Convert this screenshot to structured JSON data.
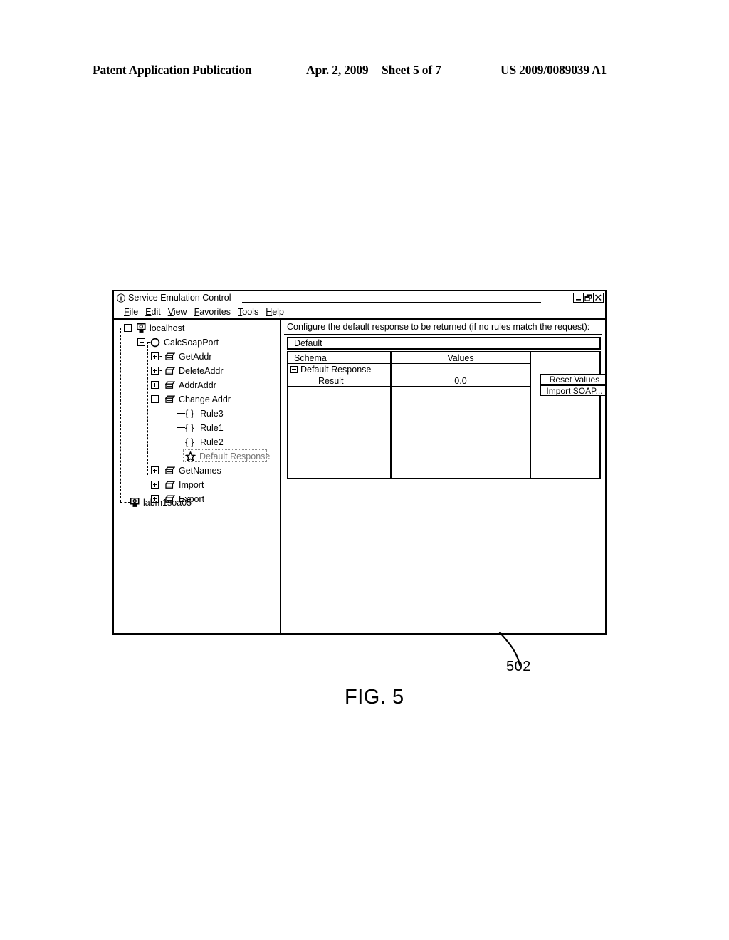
{
  "page_header": {
    "publication": "Patent Application Publication",
    "date": "Apr. 2, 2009",
    "sheet": "Sheet 5 of 7",
    "patent_number": "US 2009/0089039 A1"
  },
  "figure": {
    "reference_number": "502",
    "caption": "FIG. 5"
  },
  "window": {
    "title": "Service Emulation Control",
    "info_icon": "info-icon",
    "controls": [
      {
        "name": "minimize",
        "glyph": "minimize-icon"
      },
      {
        "name": "restore",
        "glyph": "restore-icon"
      },
      {
        "name": "close",
        "glyph": "close-icon"
      }
    ],
    "menu": [
      {
        "mnemonic": "F",
        "rest": "ile"
      },
      {
        "mnemonic": "E",
        "rest": "dit"
      },
      {
        "mnemonic": "V",
        "rest": "iew"
      },
      {
        "mnemonic": "F",
        "rest": "avorites"
      },
      {
        "mnemonic": "T",
        "rest": "ools"
      },
      {
        "mnemonic": "H",
        "rest": "elp"
      }
    ]
  },
  "tree": {
    "nodes": [
      {
        "label": "localhost",
        "icon": "computer-icon",
        "expander": "minus",
        "selected": false
      },
      {
        "label": "CalcSoapPort",
        "icon": "circle-icon",
        "expander": "minus",
        "selected": false
      },
      {
        "label": "GetAddr",
        "icon": "document-icon",
        "expander": "plus",
        "selected": false
      },
      {
        "label": "DeleteAddr",
        "icon": "document-icon",
        "expander": "plus",
        "selected": false
      },
      {
        "label": "AddrAddr",
        "icon": "document-icon",
        "expander": "plus",
        "selected": false
      },
      {
        "label": "Change Addr",
        "icon": "document-icon",
        "expander": "minus",
        "selected": false
      },
      {
        "label": "Rule3",
        "icon": "braces-icon",
        "expander": "none",
        "selected": false
      },
      {
        "label": "Rule1",
        "icon": "braces-icon",
        "expander": "none",
        "selected": false
      },
      {
        "label": "Rule2",
        "icon": "braces-icon",
        "expander": "none",
        "selected": false
      },
      {
        "label": "Default Response",
        "icon": "star-icon",
        "expander": "none",
        "selected": true
      },
      {
        "label": "GetNames",
        "icon": "document-icon",
        "expander": "plus",
        "selected": false
      },
      {
        "label": "Import",
        "icon": "document-icon",
        "expander": "plus",
        "selected": false
      },
      {
        "label": "Export",
        "icon": "document-icon",
        "expander": "plus",
        "selected": false
      },
      {
        "label": "labm1soa05",
        "icon": "computer-icon",
        "expander": "none",
        "selected": false
      }
    ]
  },
  "detail": {
    "instruction": "Configure the default response to be returned (if no rules match the request):",
    "default_field_value": "Default",
    "table": {
      "headers": [
        "Schema",
        "Values"
      ],
      "rows": [
        {
          "schema": "Default Response",
          "value": "",
          "collapse": true,
          "indent": false
        },
        {
          "schema": "Result",
          "value": "0.0",
          "collapse": false,
          "indent": true
        }
      ]
    },
    "buttons": [
      {
        "label": "Reset Values"
      },
      {
        "label": "Import SOAP..."
      }
    ]
  }
}
